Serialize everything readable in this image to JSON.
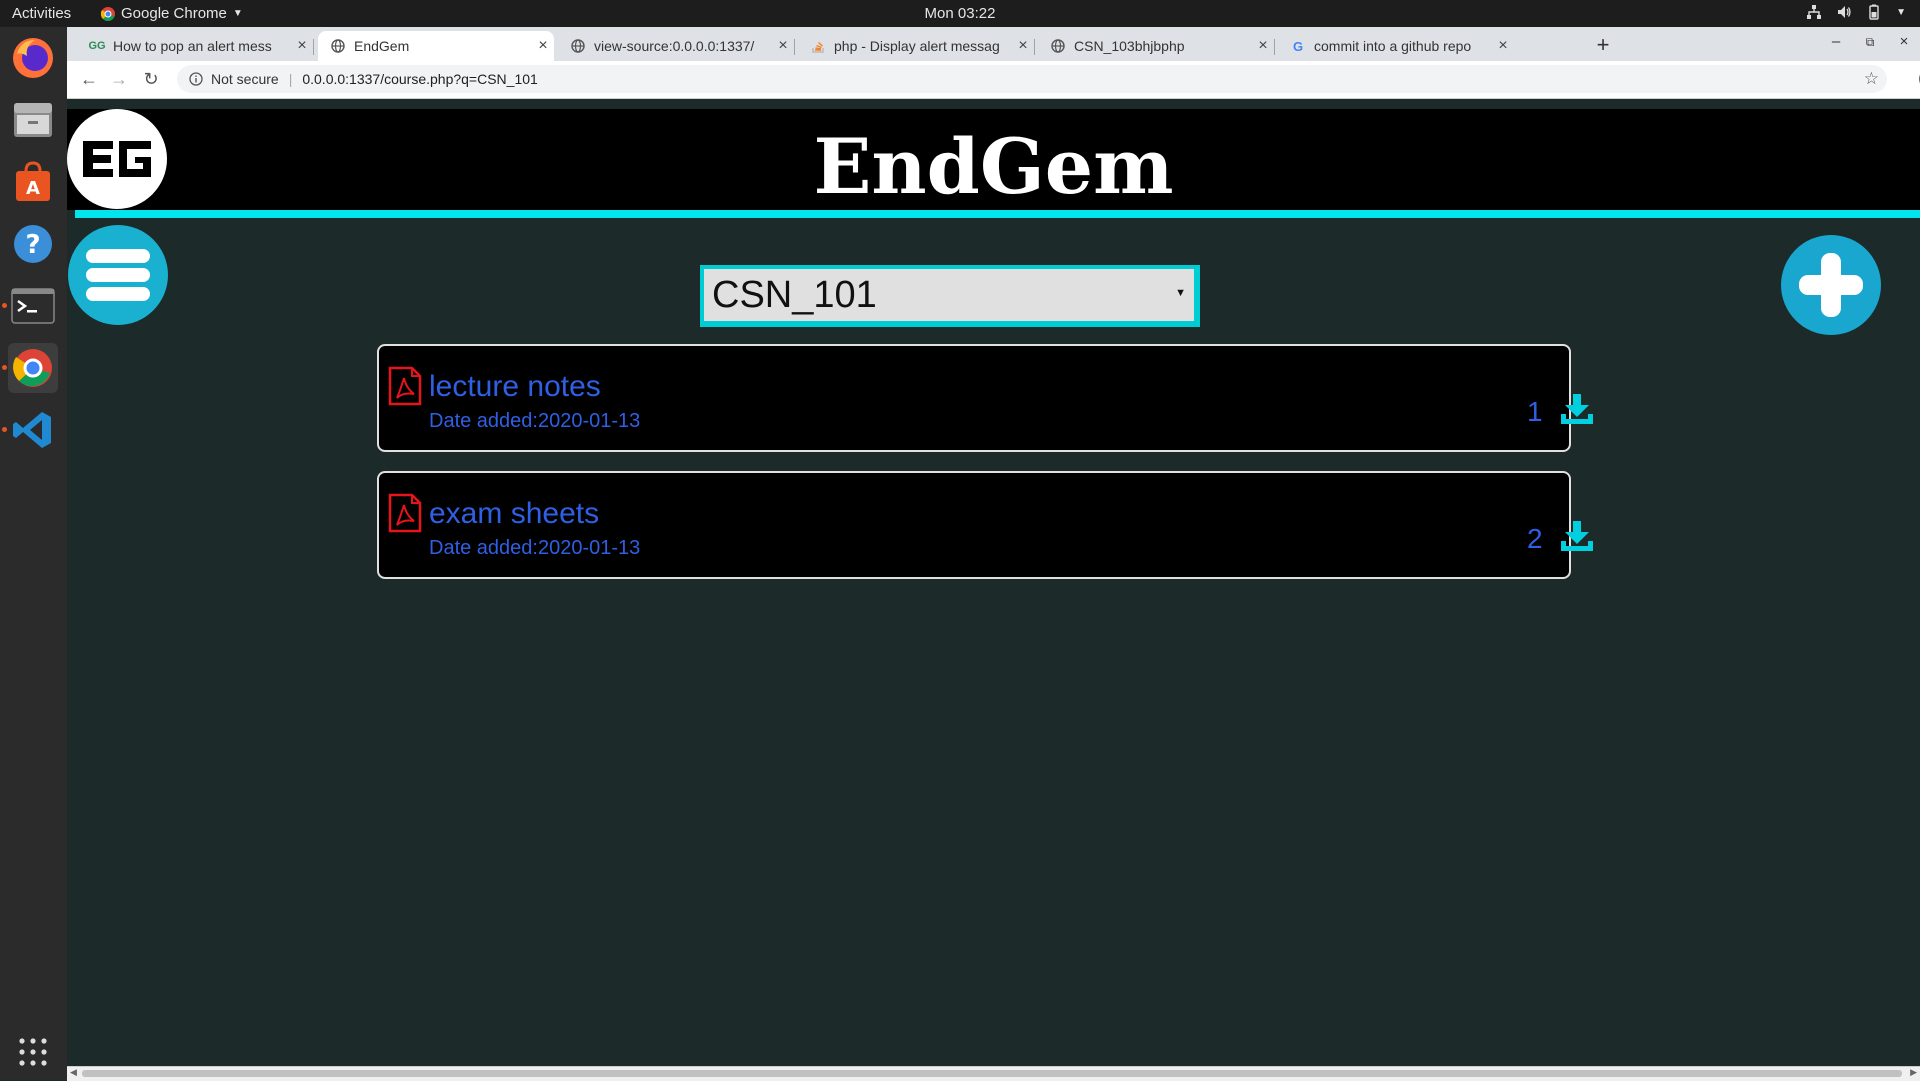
{
  "system": {
    "activities": "Activities",
    "app_name": "Google Chrome",
    "clock": "Mon 03:22"
  },
  "browser": {
    "tabs": [
      {
        "title": "How to pop an alert mess",
        "favicon": "gg-icon",
        "active": false
      },
      {
        "title": "EndGem",
        "favicon": "globe-icon",
        "active": true
      },
      {
        "title": "view-source:0.0.0.0:1337/",
        "favicon": "globe-icon",
        "active": false
      },
      {
        "title": "php - Display alert messag",
        "favicon": "stackoverflow-icon",
        "active": false
      },
      {
        "title": "CSN_103bhjbphp",
        "favicon": "globe-icon",
        "active": false
      },
      {
        "title": "commit into a github repo",
        "favicon": "google-icon",
        "active": false
      }
    ],
    "security_label": "Not secure",
    "url": "0.0.0.0:1337/course.php?q=CSN_101",
    "profile_initial": "D"
  },
  "page": {
    "site_title": "EndGem",
    "logo_text": "EG",
    "course_select": {
      "value": "CSN_101"
    },
    "files": [
      {
        "name": "lecture notes",
        "date": "Date added:2020-01-13",
        "count": "1"
      },
      {
        "name": "exam sheets",
        "date": "Date added:2020-01-13",
        "count": "2"
      }
    ]
  },
  "colors": {
    "header_bg": "#000000",
    "accent_cyan": "#00e5ee",
    "button_blue": "#19a6cf",
    "link_blue": "#2f5fe4",
    "page_bg": "#1c2a2a",
    "pdf_red": "#e8141b"
  }
}
